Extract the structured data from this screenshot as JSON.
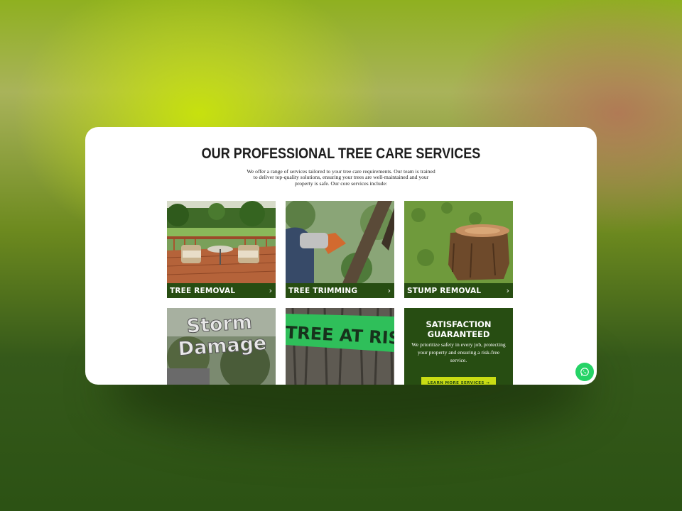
{
  "section": {
    "title": "OUR PROFESSIONAL TREE CARE SERVICES",
    "description": "We offer a range of services tailored to your tree care requirements. Our team is trained to deliver top-quality solutions, ensuring your trees are well-maintained and your property is safe. Our core services include:"
  },
  "services": [
    {
      "label": "TREE REMOVAL",
      "icon": "chevron-right-icon"
    },
    {
      "label": "TREE TRIMMING",
      "icon": "chevron-right-icon"
    },
    {
      "label": "STUMP REMOVAL",
      "icon": "chevron-right-icon"
    }
  ],
  "images": {
    "storm_text_1": "Storm",
    "storm_text_2": "Damage",
    "risk_tape": "TREE AT RIS"
  },
  "satisfaction": {
    "heading": "SATISFACTION GUARANTEED",
    "text": "We prioritize safety in every job, protecting your property and ensuring a risk-free service.",
    "button": "LEARN MORE SERVICES →"
  },
  "colors": {
    "brand_green": "#274d12",
    "accent_lime": "#c9dc14",
    "whatsapp": "#25d366"
  }
}
